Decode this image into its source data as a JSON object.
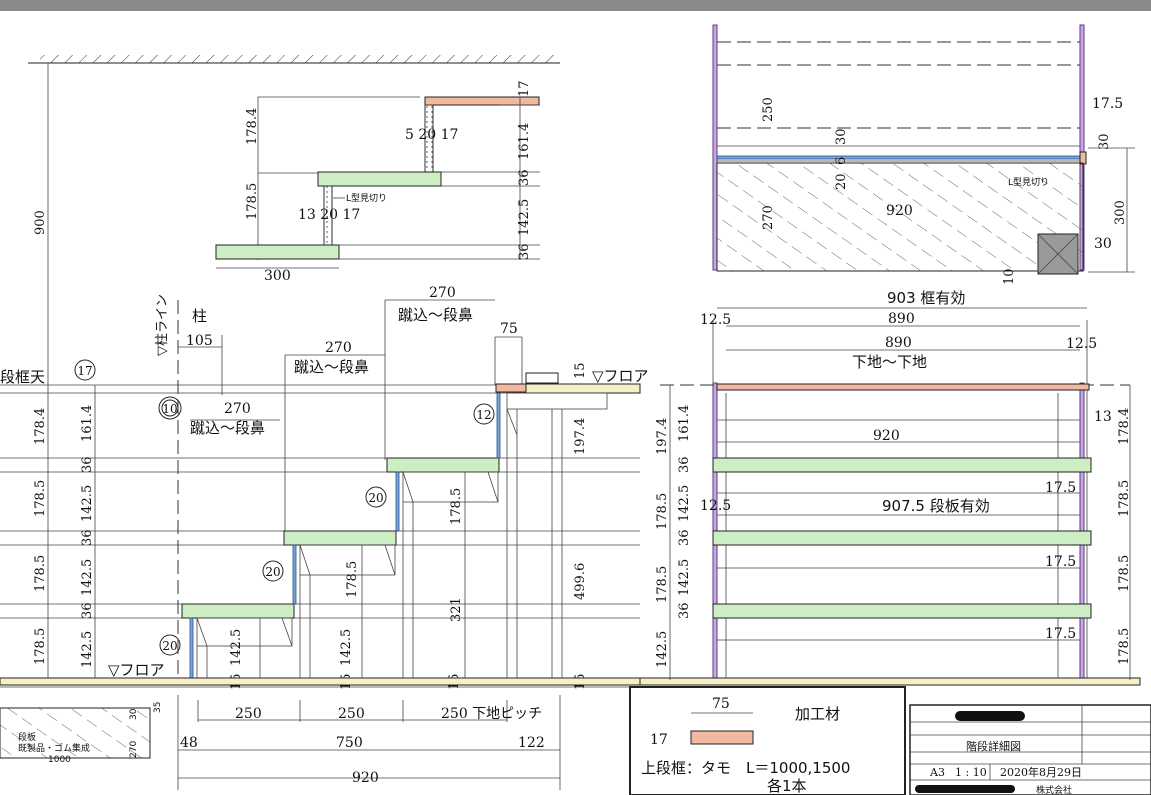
{
  "colors": {
    "tread": "#cdeec4",
    "frame": "#f2b9a0",
    "riser_plate": "#7aa7d8",
    "post": "#c9a7e6",
    "floor": "#f6f0c8"
  },
  "detail": {
    "height_total": "900",
    "dims_left": [
      "178.4",
      "178.5"
    ],
    "dims_right": [
      "17",
      "161.4",
      "36",
      "142.5",
      "36"
    ],
    "gap_top": "5 20 17",
    "gap_mid": "13 20 17",
    "lmi": "L型見切り",
    "width": "300"
  },
  "section": {
    "post_line": "▽柱ライン",
    "post": "柱",
    "post_offset": "105",
    "tread_top": "段框天",
    "circle_17": "17",
    "circle_10": "10",
    "circle_12": "12",
    "circle_20": "20",
    "run_label": "蹴込～段鼻",
    "run_270": "270",
    "frame_w": "75",
    "floor_label": "▽フロア",
    "floor_15": "15",
    "left_dims": [
      "178.4",
      "178.5",
      "178.5",
      "178.5"
    ],
    "left_dims2": [
      "161.4",
      "36",
      "142.5",
      "36",
      "142.5",
      "36",
      "142.5"
    ],
    "inner_dims": [
      "178.5",
      "178.5",
      "178.5",
      "142.5",
      "142.5"
    ],
    "small15": "15",
    "tall1": "197.4",
    "tall2": "499.6",
    "tall3": "321",
    "bottom_250": "250",
    "bottom_pitch": "250 下地ピッチ",
    "bottom_48": "48",
    "bottom_750": "750",
    "bottom_122": "122",
    "bottom_920": "920"
  },
  "plan": {
    "h250": "250",
    "d30a": "30",
    "d20": "20",
    "d6": "6",
    "d17_5": "17.5",
    "d30b": "30",
    "w920": "920",
    "h270": "270",
    "h300": "300",
    "d30c": "30",
    "d10": "10",
    "lmi": "L型見切り"
  },
  "front": {
    "frame_eff": "903 框有効",
    "w890a": "890",
    "w890b": "890",
    "sub": "下地～下地",
    "w12_5a": "12.5",
    "w12_5b": "12.5",
    "w12_5c": "12.5",
    "w920": "920",
    "tread_eff": "907.5 段板有効",
    "d13": "13",
    "d17_5": [
      "17.5",
      "17.5",
      "17.5"
    ],
    "left_dims": [
      "197.4",
      "161.4",
      "36",
      "178.5",
      "142.5",
      "36",
      "178.5",
      "142.5",
      "36",
      "142.5"
    ],
    "right_dims": [
      "178.4",
      "178.5",
      "178.5",
      "178.5"
    ]
  },
  "legend": {
    "w75": "75",
    "h17": "17",
    "material": "加工材",
    "spec": "上段框：タモ　L＝1000,1500",
    "qty": "各1本"
  },
  "mini": {
    "line1": "段板",
    "line2": "既製品・ゴム集成",
    "len": "1000",
    "d30": "30",
    "d35": "35",
    "d270": "270"
  },
  "title_block": {
    "name": "階段詳細図",
    "scale_paper": "A3",
    "scale": "1 : 10",
    "date": "2020年8月29日",
    "company": "株式会社"
  }
}
